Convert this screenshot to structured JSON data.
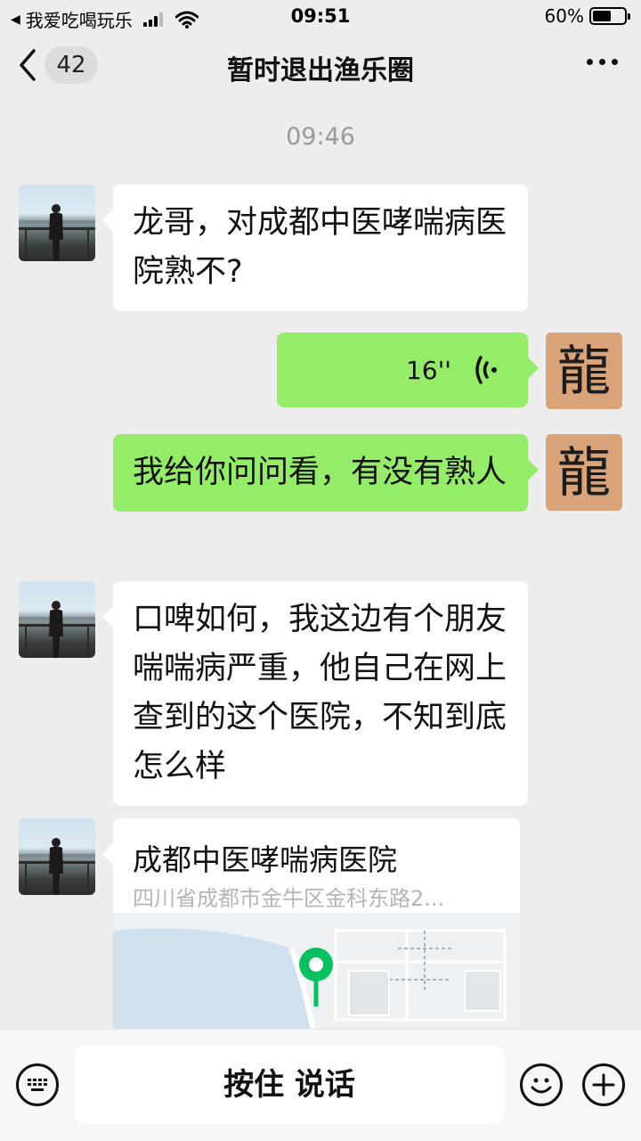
{
  "status_bar": {
    "back_app": "我爱吃喝玩乐",
    "time": "09:51",
    "battery_percent": "60%",
    "battery_level": 0.6,
    "icons": [
      "back-arrow-icon",
      "signal-icon",
      "wifi-icon",
      "battery-icon"
    ]
  },
  "nav": {
    "unread_count": "42",
    "title": "暂时退出渔乐圈",
    "icons": [
      "chevron-left-icon",
      "more-icon"
    ]
  },
  "chat": {
    "timestamp": "09:46",
    "messages": [
      {
        "side": "left",
        "type": "text",
        "avatar": "photo",
        "text": "龙哥，对成都中医哮喘病医院熟不?"
      },
      {
        "side": "right",
        "type": "voice",
        "avatar": "seal",
        "duration": "16''"
      },
      {
        "side": "right",
        "type": "text",
        "avatar": "seal",
        "text": "我给你问问看，有没有熟人"
      },
      {
        "side": "left",
        "type": "text",
        "avatar": "photo",
        "text": "口啤如何，我这边有个朋友喘喘病严重，他自己在网上查到的这个医院，不知到底怎么样"
      },
      {
        "side": "left",
        "type": "location",
        "avatar": "photo",
        "name": "成都中医哮喘病医院",
        "address": "四川省成都市金牛区金科东路2..."
      }
    ],
    "seal_char": "龍"
  },
  "input_bar": {
    "hold_to_talk": "按住 说话",
    "icons": [
      "keyboard-icon",
      "emoji-icon",
      "plus-icon"
    ]
  },
  "colors": {
    "background": "#ededed",
    "bubble_right": "#95ec69",
    "bubble_left": "#ffffff",
    "map_pin": "#07c160"
  }
}
